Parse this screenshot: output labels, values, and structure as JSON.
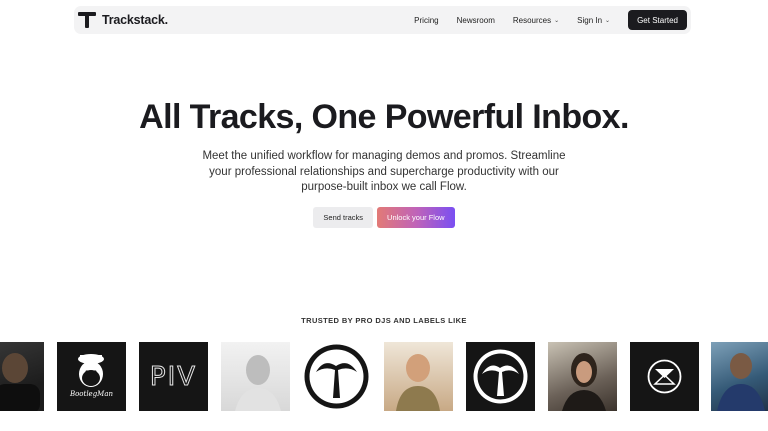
{
  "brand": {
    "name": "Trackstack."
  },
  "nav": {
    "links": [
      {
        "label": "Pricing",
        "has_dropdown": false
      },
      {
        "label": "Newsroom",
        "has_dropdown": false
      },
      {
        "label": "Resources",
        "has_dropdown": true
      },
      {
        "label": "Sign In",
        "has_dropdown": true
      }
    ],
    "cta": "Get Started"
  },
  "hero": {
    "title": "All Tracks, One Powerful Inbox.",
    "subtitle": "Meet the unified workflow for managing demos and promos. Streamline your professional relationships and supercharge productivity with our purpose-built inbox we call Flow.",
    "secondary_button": "Send tracks",
    "primary_button": "Unlock your Flow"
  },
  "trusted": {
    "heading": "TRUSTED BY PRO DJS AND LABELS LIKE",
    "logo_text_piv": "PIV",
    "logo_text_bootleg": "BootlegMan"
  },
  "colors": {
    "text": "#1b1b1f",
    "nav_bg": "#f3f3f4",
    "cta_bg": "#1b1b1f",
    "gradient_start": "#e27a76",
    "gradient_end": "#7a4ff2"
  }
}
